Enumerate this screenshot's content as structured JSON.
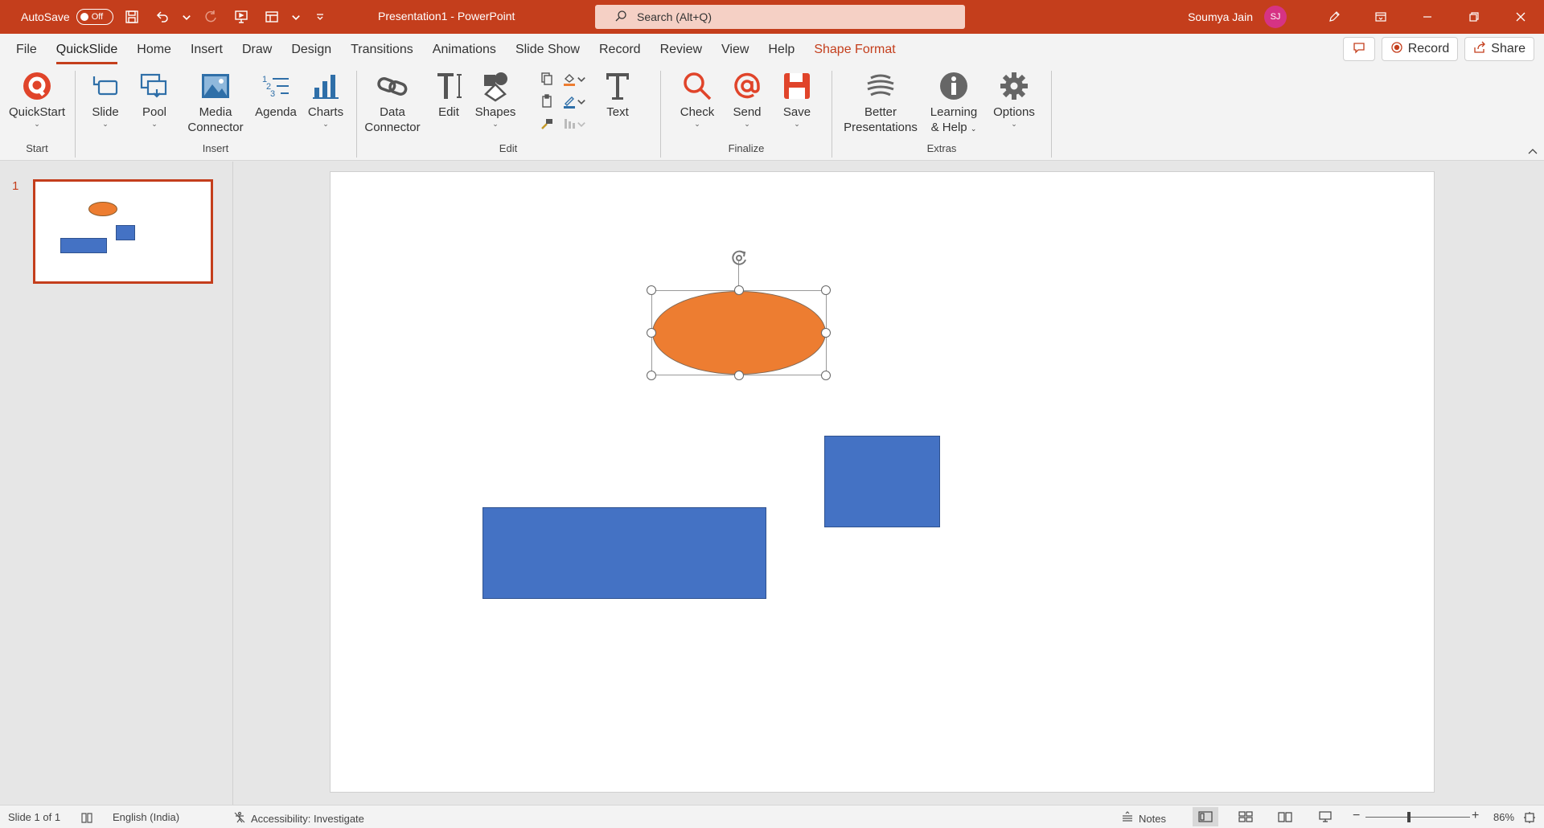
{
  "titlebar": {
    "autosave_label": "AutoSave",
    "autosave_state": "Off",
    "doc_title": "Presentation1  -  PowerPoint",
    "search_placeholder": "Search (Alt+Q)",
    "user_name": "Soumya Jain",
    "user_initials": "SJ",
    "accent_color": "#c43e1c"
  },
  "tabs": [
    {
      "label": "File"
    },
    {
      "label": "QuickSlide"
    },
    {
      "label": "Home"
    },
    {
      "label": "Insert"
    },
    {
      "label": "Draw"
    },
    {
      "label": "Design"
    },
    {
      "label": "Transitions"
    },
    {
      "label": "Animations"
    },
    {
      "label": "Slide Show"
    },
    {
      "label": "Record"
    },
    {
      "label": "Review"
    },
    {
      "label": "View"
    },
    {
      "label": "Help"
    },
    {
      "label": "Shape Format"
    }
  ],
  "tabs_right": {
    "record_label": "Record",
    "share_label": "Share"
  },
  "ribbon": {
    "groups": {
      "start": "Start",
      "insert": "Insert",
      "edit": "Edit",
      "finalize": "Finalize",
      "extras": "Extras"
    },
    "buttons": {
      "quickstart": "QuickStart",
      "slide": "Slide",
      "pool": "Pool",
      "media_connector_1": "Media",
      "media_connector_2": "Connector",
      "agenda": "Agenda",
      "charts": "Charts",
      "data_connector_1": "Data",
      "data_connector_2": "Connector",
      "edit": "Edit",
      "shapes": "Shapes",
      "text": "Text",
      "check": "Check",
      "send": "Send",
      "save": "Save",
      "better_presentations_1": "Better",
      "better_presentations_2": "Presentations",
      "learning_help_1": "Learning",
      "learning_help_2": "& Help",
      "options": "Options"
    }
  },
  "thumbnails": [
    {
      "number": "1"
    }
  ],
  "slide": {
    "shapes": [
      {
        "type": "ellipse",
        "fill": "#ed7d31",
        "selected": true
      },
      {
        "type": "rectangle",
        "fill": "#4472c4"
      },
      {
        "type": "rectangle",
        "fill": "#4472c4"
      }
    ]
  },
  "statusbar": {
    "slide_info": "Slide 1 of 1",
    "language": "English (India)",
    "accessibility": "Accessibility: Investigate",
    "notes_label": "Notes",
    "zoom_minus": "−",
    "zoom_plus": "+",
    "zoom_level": "86%"
  }
}
